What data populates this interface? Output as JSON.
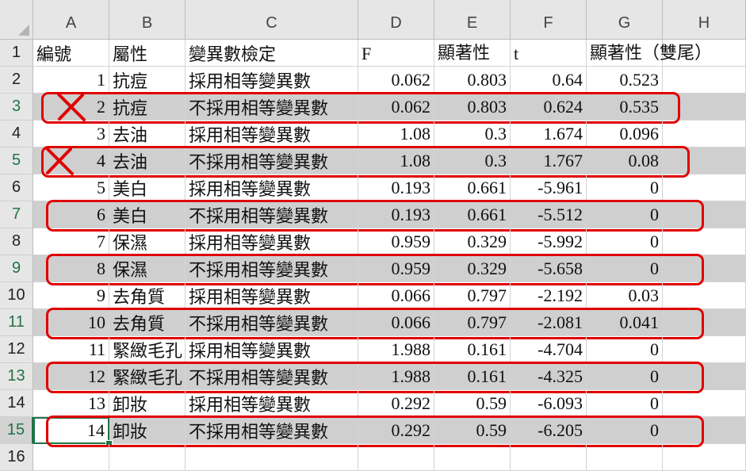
{
  "columns": [
    "A",
    "B",
    "C",
    "D",
    "E",
    "F",
    "G",
    "H"
  ],
  "row_numbers": [
    "1",
    "2",
    "3",
    "4",
    "5",
    "6",
    "7",
    "8",
    "9",
    "10",
    "11",
    "12",
    "13",
    "14",
    "15",
    "16"
  ],
  "rows": [
    {
      "A": "編號",
      "B": "屬性",
      "C": "變異數檢定",
      "D": "F",
      "E": "顯著性",
      "F": "t",
      "G": "顯著性（雙尾）"
    },
    {
      "A": "1",
      "B": "抗痘",
      "C": "採用相等變異數",
      "D": "0.062",
      "E": "0.803",
      "F": "0.64",
      "G": "0.523"
    },
    {
      "A": "2",
      "B": "抗痘",
      "C": "不採用相等變異數",
      "D": "0.062",
      "E": "0.803",
      "F": "0.624",
      "G": "0.535"
    },
    {
      "A": "3",
      "B": "去油",
      "C": "採用相等變異數",
      "D": "1.08",
      "E": "0.3",
      "F": "1.674",
      "G": "0.096"
    },
    {
      "A": "4",
      "B": "去油",
      "C": "不採用相等變異數",
      "D": "1.08",
      "E": "0.3",
      "F": "1.767",
      "G": "0.08"
    },
    {
      "A": "5",
      "B": "美白",
      "C": "採用相等變異數",
      "D": "0.193",
      "E": "0.661",
      "F": "-5.961",
      "G": "0"
    },
    {
      "A": "6",
      "B": "美白",
      "C": "不採用相等變異數",
      "D": "0.193",
      "E": "0.661",
      "F": "-5.512",
      "G": "0"
    },
    {
      "A": "7",
      "B": "保濕",
      "C": "採用相等變異數",
      "D": "0.959",
      "E": "0.329",
      "F": "-5.992",
      "G": "0"
    },
    {
      "A": "8",
      "B": "保濕",
      "C": "不採用相等變異數",
      "D": "0.959",
      "E": "0.329",
      "F": "-5.658",
      "G": "0"
    },
    {
      "A": "9",
      "B": "去角質",
      "C": "採用相等變異數",
      "D": "0.066",
      "E": "0.797",
      "F": "-2.192",
      "G": "0.03"
    },
    {
      "A": "10",
      "B": "去角質",
      "C": "不採用相等變異數",
      "D": "0.066",
      "E": "0.797",
      "F": "-2.081",
      "G": "0.041"
    },
    {
      "A": "11",
      "B": "緊緻毛孔",
      "C": "採用相等變異數",
      "D": "1.988",
      "E": "0.161",
      "F": "-4.704",
      "G": "0"
    },
    {
      "A": "12",
      "B": "緊緻毛孔",
      "C": "不採用相等變異數",
      "D": "1.988",
      "E": "0.161",
      "F": "-4.325",
      "G": "0"
    },
    {
      "A": "13",
      "B": "卸妝",
      "C": "採用相等變異數",
      "D": "0.292",
      "E": "0.59",
      "F": "-6.093",
      "G": "0"
    },
    {
      "A": "14",
      "B": "卸妝",
      "C": "不採用相等變異數",
      "D": "0.292",
      "E": "0.59",
      "F": "-6.205",
      "G": "0"
    },
    {
      "A": "",
      "B": "",
      "C": "",
      "D": "",
      "E": "",
      "F": "",
      "G": ""
    }
  ],
  "shaded_rows": [
    "3",
    "5",
    "7",
    "9",
    "11",
    "13",
    "15"
  ],
  "crossed_rows": [
    "3",
    "5"
  ],
  "active_cell": "A15",
  "colors": {
    "highlight": "#e00000",
    "shade": "#cfcfcf",
    "selection": "#217346",
    "header_bg": "#e6e6e6"
  }
}
